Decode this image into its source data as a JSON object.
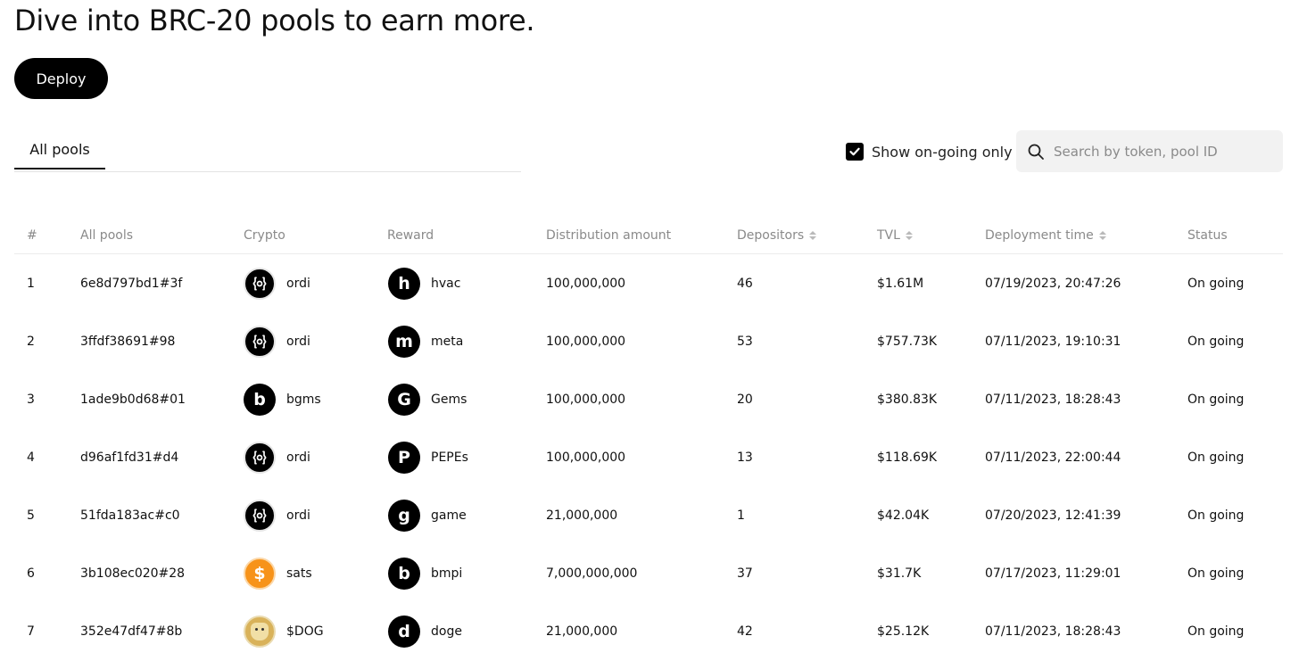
{
  "header": {
    "title": "Dive into BRC-20 pools to earn more.",
    "deploy_label": "Deploy"
  },
  "tabs": [
    {
      "label": "All pools",
      "active": true
    }
  ],
  "filter": {
    "label": "Show on-going only",
    "checked": true
  },
  "search": {
    "placeholder": "Search by token, pool ID",
    "value": "",
    "icon": "search-icon"
  },
  "table": {
    "columns": {
      "index": "#",
      "pool": "All pools",
      "crypto": "Crypto",
      "reward": "Reward",
      "distribution": "Distribution amount",
      "depositors": "Depositors",
      "tvl": "TVL",
      "deployment_time": "Deployment time",
      "status": "Status"
    },
    "sortable": [
      "depositors",
      "tvl",
      "deployment_time"
    ],
    "rows": [
      {
        "index": "1",
        "pool_id": "6e8d797bd1#3f",
        "crypto": "ordi",
        "crypto_icon": "ordi-icon",
        "reward": "hvac",
        "reward_glyph": "h",
        "distribution": "100,000,000",
        "depositors": "46",
        "tvl": "$1.61M",
        "deployed": "07/19/2023, 20:47:26",
        "status": "On going"
      },
      {
        "index": "2",
        "pool_id": "3ffdf38691#98",
        "crypto": "ordi",
        "crypto_icon": "ordi-icon",
        "reward": "meta",
        "reward_glyph": "m",
        "distribution": "100,000,000",
        "depositors": "53",
        "tvl": "$757.73K",
        "deployed": "07/11/2023, 19:10:31",
        "status": "On going"
      },
      {
        "index": "3",
        "pool_id": "1ade9b0d68#01",
        "crypto": "bgms",
        "crypto_icon": "letter-b-icon",
        "crypto_glyph": "b",
        "reward": "Gems",
        "reward_glyph": "G",
        "distribution": "100,000,000",
        "depositors": "20",
        "tvl": "$380.83K",
        "deployed": "07/11/2023, 18:28:43",
        "status": "On going"
      },
      {
        "index": "4",
        "pool_id": "d96af1fd31#d4",
        "crypto": "ordi",
        "crypto_icon": "ordi-icon",
        "reward": "PEPEs",
        "reward_glyph": "P",
        "distribution": "100,000,000",
        "depositors": "13",
        "tvl": "$118.69K",
        "deployed": "07/11/2023, 22:00:44",
        "status": "On going"
      },
      {
        "index": "5",
        "pool_id": "51fda183ac#c0",
        "crypto": "ordi",
        "crypto_icon": "ordi-icon",
        "reward": "game",
        "reward_glyph": "g",
        "distribution": "21,000,000",
        "depositors": "1",
        "tvl": "$42.04K",
        "deployed": "07/20/2023, 12:41:39",
        "status": "On going"
      },
      {
        "index": "6",
        "pool_id": "3b108ec020#28",
        "crypto": "sats",
        "crypto_icon": "sats-icon",
        "reward": "bmpi",
        "reward_glyph": "b",
        "distribution": "7,000,000,000",
        "depositors": "37",
        "tvl": "$31.7K",
        "deployed": "07/17/2023, 11:29:01",
        "status": "On going"
      },
      {
        "index": "7",
        "pool_id": "352e47df47#8b",
        "crypto": "$DOG",
        "crypto_icon": "dog-icon",
        "reward": "doge",
        "reward_glyph": "d",
        "distribution": "21,000,000",
        "depositors": "42",
        "tvl": "$25.12K",
        "deployed": "07/11/2023, 18:28:43",
        "status": "On going"
      }
    ]
  },
  "colors": {
    "primary": "#000000",
    "muted_text": "#8a8a8a",
    "search_bg": "#f2f2f2",
    "sats_orange": "#f7931a"
  }
}
